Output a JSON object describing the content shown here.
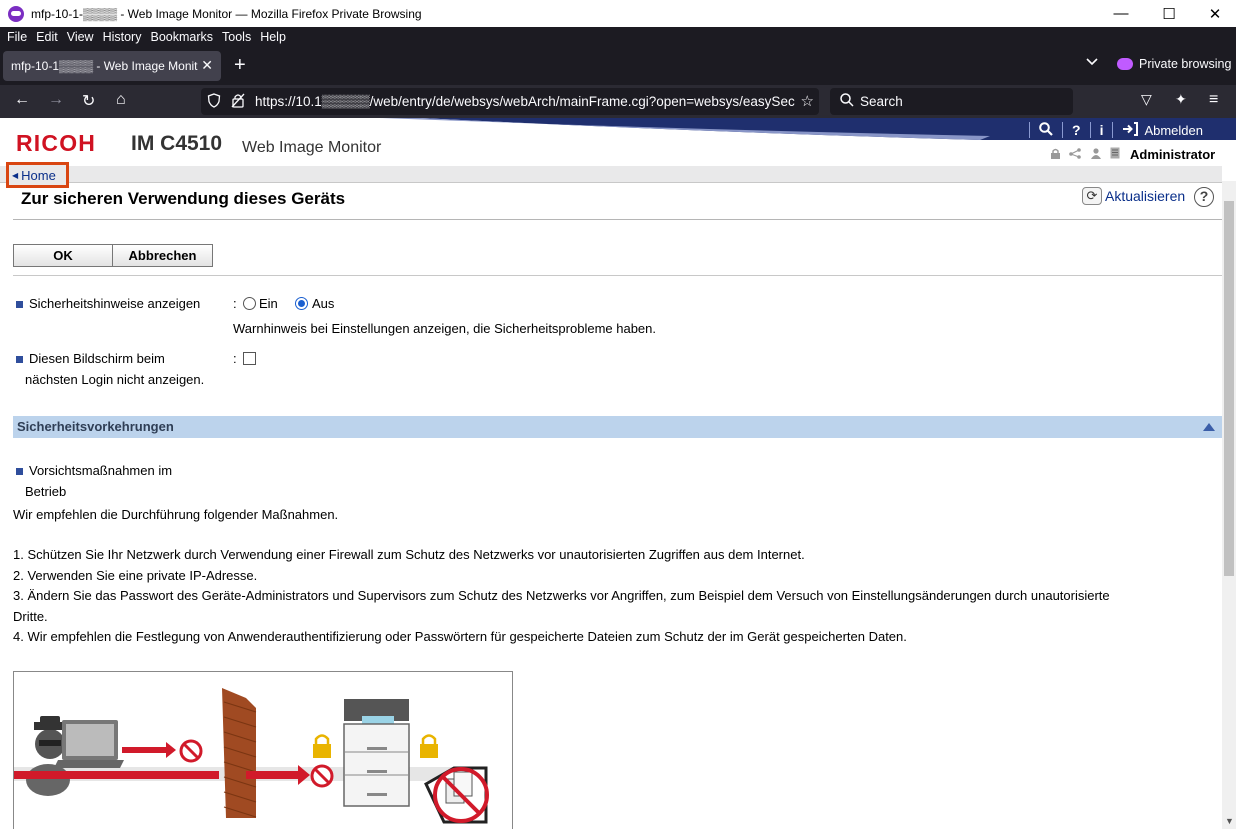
{
  "window": {
    "title": "mfp-10-1-▒▒▒▒ - Web Image Monitor — Mozilla Firefox Private Browsing",
    "minimize": "—",
    "maximize": "☐",
    "close": "✕"
  },
  "menu": {
    "items": [
      "File",
      "Edit",
      "View",
      "History",
      "Bookmarks",
      "Tools",
      "Help"
    ]
  },
  "tabs": {
    "active_label": "mfp-10-1▒▒▒▒ - Web Image Monit",
    "close": "✕",
    "new_tab": "+",
    "list_all": "⌄",
    "private_label": "Private browsing"
  },
  "nav": {
    "back": "←",
    "forward": "→",
    "reload": "↻",
    "home": "⌂",
    "url": "https://10.1▒▒▒▒▒/web/entry/de/websys/webArch/mainFrame.cgi?open=websys/easySec",
    "search_placeholder": "Search",
    "star": "☆",
    "pocket": "▽",
    "extensions": "✦",
    "menu": "≡"
  },
  "header": {
    "logo": "RICOH",
    "model": "IM C4510",
    "product": "Web Image Monitor",
    "logout_label": "Abmelden",
    "user_role": "Administrator"
  },
  "breadcrumb": {
    "home_label": "Home"
  },
  "main": {
    "title": "Zur sicheren Verwendung dieses Geräts",
    "refresh_label": "Aktualisieren",
    "ok_label": "OK",
    "cancel_label": "Abbrechen",
    "setting1": {
      "label": "Sicherheitshinweise anzeigen",
      "colon": ":",
      "option_on": "Ein",
      "option_off": "Aus",
      "selected": "Aus",
      "hint": "Warnhinweis bei Einstellungen anzeigen, die Sicherheitsprobleme haben."
    },
    "setting2": {
      "label_line1": "Diesen Bildschirm beim",
      "label_line2": "nächsten Login nicht anzeigen.",
      "colon": ":",
      "checked": false
    },
    "section": {
      "title": "Sicherheitsvorkehrungen",
      "sub_label_line1": "Vorsichtsmaßnahmen im",
      "sub_label_line2": "Betrieb",
      "intro": "Wir empfehlen die Durchführung folgender Maßnahmen.",
      "items": [
        "1. Schützen Sie Ihr Netzwerk durch Verwendung einer Firewall zum Schutz des Netzwerks vor unautorisierten Zugriffen aus dem Internet.",
        "2. Verwenden Sie eine private IP-Adresse.",
        "3. Ändern Sie das Passwort des Geräte-Administrators und Supervisors zum Schutz des Netzwerks vor Angriffen, zum Beispiel dem Versuch von Einstellungsänderungen durch unautorisierte",
        "Dritte.",
        "4. Wir empfehlen die Festlegung von Anwenderauthentifizierung oder Passwörtern für gespeicherte Dateien zum Schutz der im Gerät gespeicherten Daten."
      ]
    }
  },
  "colors": {
    "brand_red": "#d01222",
    "link_blue": "#0a2f8a",
    "section_bg": "#bcd3ec",
    "header_band": "#1f2f6e",
    "highlight": "#d94612"
  }
}
